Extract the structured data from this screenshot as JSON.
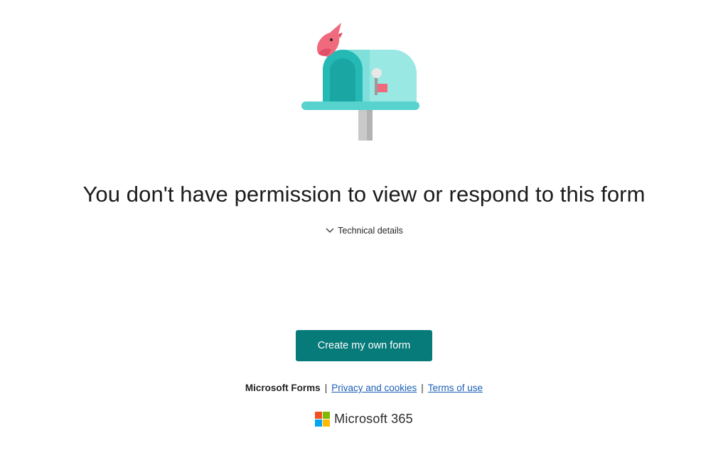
{
  "main": {
    "headline": "You don't have permission to view or respond to this form",
    "technical_details_label": "Technical details",
    "create_button_label": "Create my own form",
    "illustration_icon": "mailbox-with-bird-illustration"
  },
  "footer": {
    "brand": "Microsoft Forms",
    "separator": "|",
    "privacy_link": "Privacy and cookies",
    "terms_link": "Terms of use"
  },
  "product": {
    "label": "Microsoft 365",
    "logo_icon": "microsoft-logo-icon",
    "logo_colors": [
      "#f25022",
      "#7fba00",
      "#00a4ef",
      "#ffb900"
    ]
  },
  "colors": {
    "accent": "#077a7a",
    "link": "#1a5fb4",
    "mailbox": "#3cc8c4",
    "bird": "#f06a7e"
  }
}
